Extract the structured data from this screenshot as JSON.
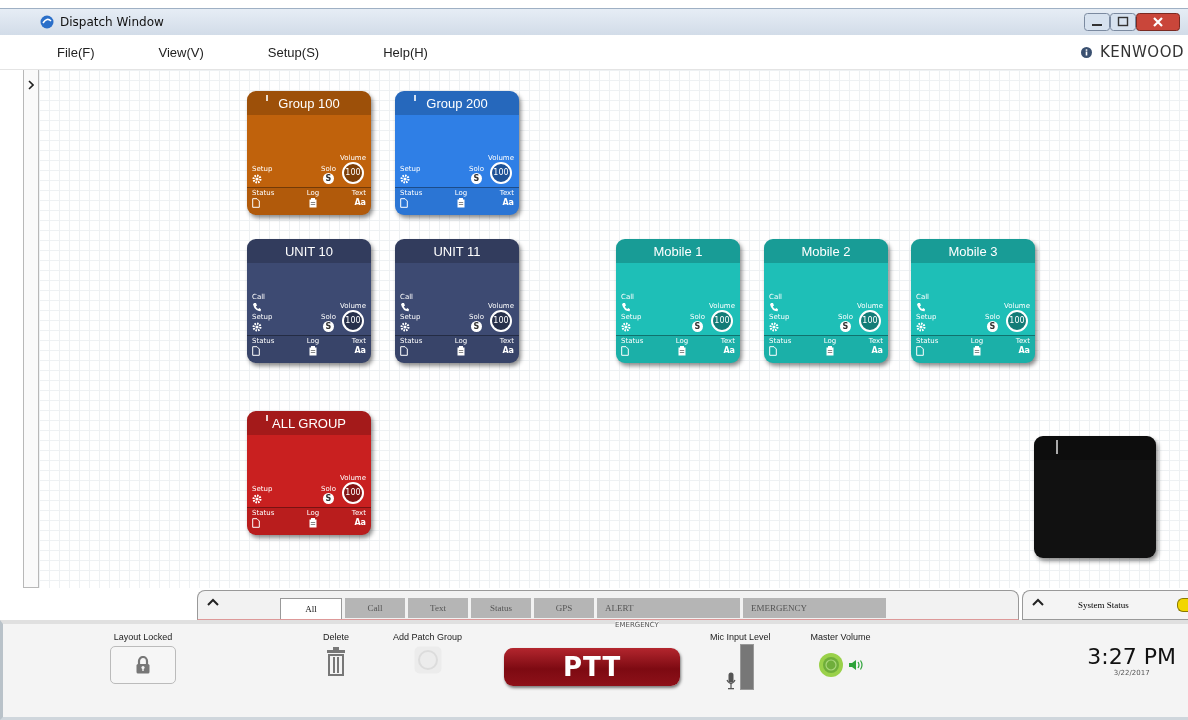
{
  "window": {
    "title": "Dispatch Window"
  },
  "menu": [
    "File(F)",
    "View(V)",
    "Setup(S)",
    "Help(H)"
  ],
  "brand": "KENWOOD",
  "tiles": [
    {
      "kind": "group",
      "title": "Group 100",
      "color": "#c0620c",
      "setup": "Setup",
      "solo": "Solo",
      "solo_glyph": "S",
      "volume_label": "Volume",
      "volume": "100",
      "status": "Status",
      "log": "Log",
      "text": "Text",
      "text_glyph": "Aa"
    },
    {
      "kind": "group",
      "title": "Group 200",
      "color": "#2f7fe6",
      "setup": "Setup",
      "solo": "Solo",
      "solo_glyph": "S",
      "volume_label": "Volume",
      "volume": "100",
      "status": "Status",
      "log": "Log",
      "text": "Text",
      "text_glyph": "Aa"
    },
    {
      "kind": "unit",
      "title": "UNIT 10",
      "color": "#3d4a72",
      "call": "Call",
      "setup": "Setup",
      "solo": "Solo",
      "solo_glyph": "S",
      "volume_label": "Volume",
      "volume": "100",
      "status": "Status",
      "log": "Log",
      "text": "Text",
      "text_glyph": "Aa"
    },
    {
      "kind": "unit",
      "title": "UNIT 11",
      "color": "#3d4a72",
      "call": "Call",
      "setup": "Setup",
      "solo": "Solo",
      "solo_glyph": "S",
      "volume_label": "Volume",
      "volume": "100",
      "status": "Status",
      "log": "Log",
      "text": "Text",
      "text_glyph": "Aa"
    },
    {
      "kind": "unit",
      "title": "Mobile 1",
      "color": "#1ebfb7",
      "call": "Call",
      "setup": "Setup",
      "solo": "Solo",
      "solo_glyph": "S",
      "volume_label": "Volume",
      "volume": "100",
      "status": "Status",
      "log": "Log",
      "text": "Text",
      "text_glyph": "Aa"
    },
    {
      "kind": "unit",
      "title": "Mobile 2",
      "color": "#1ebfb7",
      "call": "Call",
      "setup": "Setup",
      "solo": "Solo",
      "solo_glyph": "S",
      "volume_label": "Volume",
      "volume": "100",
      "status": "Status",
      "log": "Log",
      "text": "Text",
      "text_glyph": "Aa"
    },
    {
      "kind": "unit",
      "title": "Mobile 3",
      "color": "#1ebfb7",
      "call": "Call",
      "setup": "Setup",
      "solo": "Solo",
      "solo_glyph": "S",
      "volume_label": "Volume",
      "volume": "100",
      "status": "Status",
      "log": "Log",
      "text": "Text",
      "text_glyph": "Aa"
    },
    {
      "kind": "group",
      "title": "ALL GROUP",
      "color": "#c92020",
      "setup": "Setup",
      "solo": "Solo",
      "solo_glyph": "S",
      "volume_label": "Volume",
      "volume": "100",
      "status": "Status",
      "log": "Log",
      "text": "Text",
      "text_glyph": "Aa"
    },
    {
      "kind": "blank",
      "color": "#111111"
    }
  ],
  "filter_tabs": [
    {
      "label": "All",
      "selected": true
    },
    {
      "label": "Call",
      "selected": false
    },
    {
      "label": "Text",
      "selected": false
    },
    {
      "label": "Status",
      "selected": false
    },
    {
      "label": "GPS",
      "selected": false
    },
    {
      "label": "ALERT",
      "selected": false
    },
    {
      "label": "EMERGENCY",
      "selected": false
    }
  ],
  "emergency_caption": "EMERGENCY",
  "system_status": {
    "label": "System Status"
  },
  "toolbar": {
    "layout": {
      "label": "Layout Locked"
    },
    "delete": {
      "label": "Delete"
    },
    "patch": {
      "label": "Add Patch Group",
      "disabled": true
    },
    "ptt": "PTT",
    "mic": {
      "label": "Mic Input Level"
    },
    "master": {
      "label": "Master Volume"
    },
    "time": "3:27 PM",
    "date": "3/22/2017"
  }
}
